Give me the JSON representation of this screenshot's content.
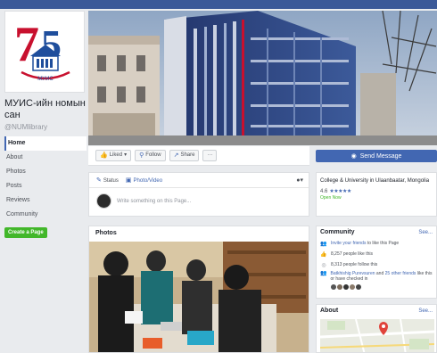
{
  "sidebar": {
    "logo_text": "МУИС",
    "page_name": "МУИС-ийн номын сан",
    "page_handle": "@NUMlibrary",
    "nav": [
      "Home",
      "About",
      "Photos",
      "Posts",
      "Reviews",
      "Community"
    ],
    "create_page": "Create a Page"
  },
  "actions": {
    "liked": "Liked",
    "follow": "Follow",
    "share": "Share",
    "more": "···",
    "send_message": "Send Message"
  },
  "composer": {
    "status": "Status",
    "photo_video": "Photo/Video",
    "placeholder": "Write something on this Page..."
  },
  "photos": {
    "title": "Photos"
  },
  "info": {
    "category": "College & University in Ulaanbaatar, Mongolia",
    "rating": "4.6",
    "stars": "★★★★★",
    "open_now": "Open Now"
  },
  "community": {
    "title": "Community",
    "see_all": "See...",
    "invite_link": "Invite your friends",
    "invite_rest": "to like this Page",
    "likes": "8,257 people like this",
    "follows": "8,313 people follow this",
    "checkins_link": "Batkhishig Purevsuren",
    "checkins_mid": "and",
    "checkins_link2": "25 other friends",
    "checkins_rest": "like this or have checked in"
  },
  "about": {
    "title": "About",
    "see_all": "See..."
  },
  "colors": {
    "brand": "#3b5998",
    "button": "#4267b2",
    "green": "#42b72a"
  }
}
